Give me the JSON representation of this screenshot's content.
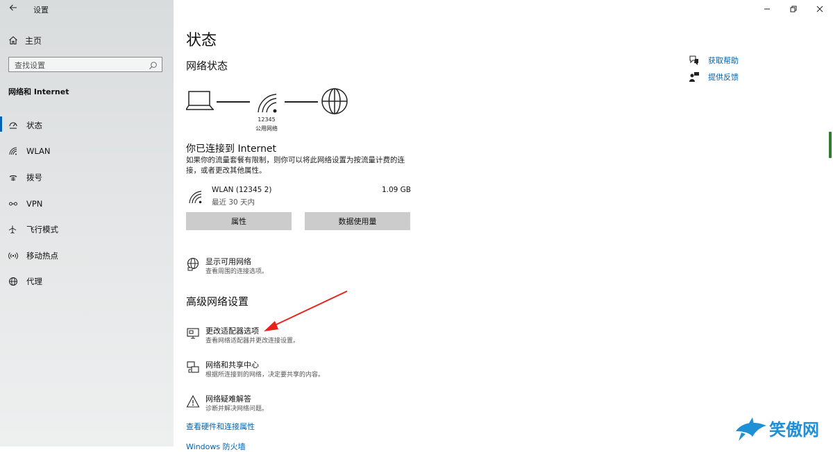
{
  "window": {
    "title": "设置"
  },
  "sidebar": {
    "home_label": "主页",
    "search_placeholder": "查找设置",
    "section": "网络和 Internet",
    "items": [
      {
        "label": "状态",
        "icon": "status-icon"
      },
      {
        "label": "WLAN",
        "icon": "wifi-icon"
      },
      {
        "label": "拨号",
        "icon": "dialup-icon"
      },
      {
        "label": "VPN",
        "icon": "vpn-icon"
      },
      {
        "label": "飞行模式",
        "icon": "airplane-icon"
      },
      {
        "label": "移动热点",
        "icon": "hotspot-icon"
      },
      {
        "label": "代理",
        "icon": "globe-icon"
      }
    ]
  },
  "main": {
    "title": "状态",
    "network_status_heading": "网络状态",
    "diagram": {
      "network_name": "12345",
      "network_type": "公用网络"
    },
    "connection": {
      "title": "你已连接到 Internet",
      "description": "如果你的流量套餐有限制，则你可以将此网络设置为按流量计费的连接，或者更改其他属性。"
    },
    "adapter": {
      "name": "WLAN (12345 2)",
      "period": "最近 30 天内",
      "usage": "1.09 GB"
    },
    "buttons": {
      "properties": "属性",
      "data_usage": "数据使用量"
    },
    "show_networks": {
      "title": "显示可用网络",
      "desc": "查看周围的连接选项。"
    },
    "advanced_heading": "高级网络设置",
    "advanced_options": [
      {
        "title": "更改适配器选项",
        "desc": "查看网络适配器并更改连接设置。"
      },
      {
        "title": "网络和共享中心",
        "desc": "根据所连接到的网络，决定要共享的内容。"
      },
      {
        "title": "网络疑难解答",
        "desc": "诊断并解决网络问题。"
      }
    ],
    "links": [
      "查看硬件和连接属性",
      "Windows 防火墙"
    ],
    "help": {
      "get_help": "获取帮助",
      "feedback": "提供反馈"
    }
  },
  "accent_color": "#0063b1",
  "annotation_color": "#e8221b",
  "watermark_text": "笑傲网"
}
